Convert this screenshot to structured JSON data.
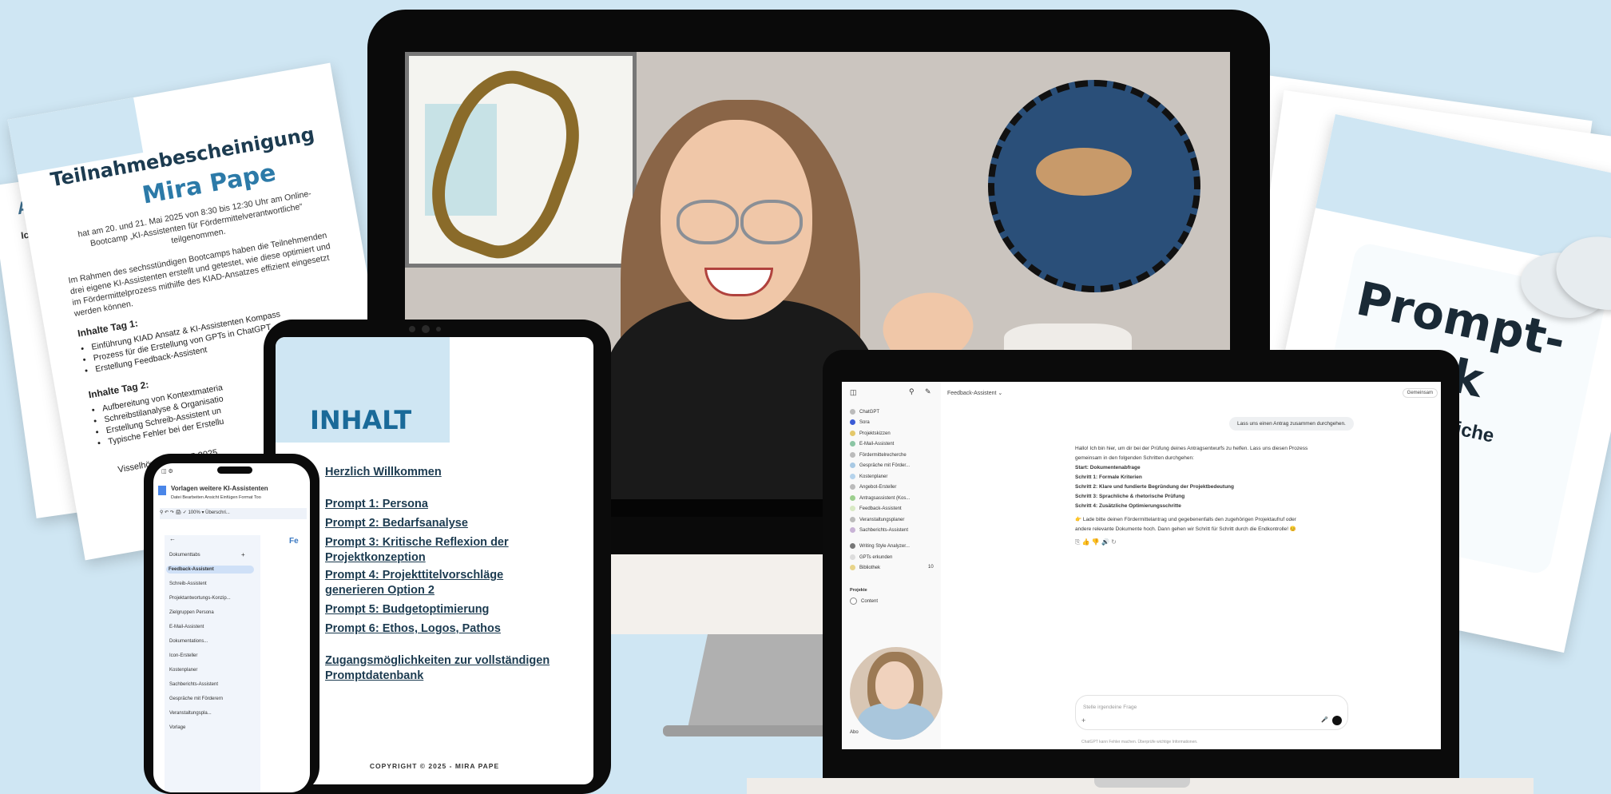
{
  "certificate": {
    "title": "Teilnahmebescheinigung",
    "name": "Mira Pape",
    "intro": "hat am 20. und 21. Mai 2025 von 8:30 bis 12:30 Uhr am Online-Bootcamp „KI-Assistenten für Fördermittelverantwortliche“ teilgenommen.",
    "body": "Im Rahmen des sechsstündigen Bootcamps haben die Teilnehmenden drei eigene KI-Assistenten erstellt und getestet, wie diese optimiert und im Fördermittelprozess mithilfe des KIAD-Ansatzes effizient eingesetzt werden können.",
    "day1_heading": "Inhalte Tag 1:",
    "day1_items": [
      "Einführung KIAD Ansatz & KI-Assistenten Kompass",
      "Prozess für die Erstellung von GPTs in ChatGPT",
      "Erstellung Feedback-Assistent"
    ],
    "day2_heading": "Inhalte Tag 2:",
    "day2_items": [
      "Aufbereitung von Kontextmateria",
      "Schreibstilanalyse & Organisatio",
      "Erstellung Schreib-Assistent un",
      "Typische Fehler bei der Erstellu"
    ],
    "place_date": "Visselhövede, 23.05.2025",
    "back_label": "Anle",
    "back_label2": "Icon"
  },
  "tablet": {
    "heading": "INHALT",
    "toc": [
      "Herzlich Willkommen",
      "Prompt 1: Persona",
      "Prompt 2: Bedarfsanalyse",
      "Prompt 3: Kritische Reflexion der Projektkonzeption",
      "Prompt 4: Projekttitelvorschläge generieren Option 2",
      "Prompt 5: Budgetoptimierung",
      "Prompt 6: Ethos, Logos, Pathos",
      "Zugangsmöglichkeiten zur vollständigen Promptdatenbank"
    ],
    "copyright": "COPYRIGHT © 2025 - MIRA PAPE"
  },
  "phone": {
    "doc_title": "Vorlagen weitere KI-Assistenten",
    "menu": [
      "Datei",
      "Bearbeiten",
      "Ansicht",
      "Einfügen",
      "Format",
      "Too"
    ],
    "zoom": "100%",
    "style": "Überschri...",
    "tabs_label": "Dokumenttabs",
    "items": [
      "Feedback-Assistent",
      "Schreib-Assistent",
      "Projektantwortungs-Konzip...",
      "Zielgruppen Persona",
      "E-Mail-Assistent",
      "Dokumentations...",
      "Icon-Ersteller",
      "Kostenplaner",
      "Sachberichts-Assistent",
      "Gespräche mit Förderern",
      "Veranstaltungspla...",
      "Vorlage"
    ],
    "side_text": "Fe"
  },
  "chatgpt": {
    "header": "Feedback-Assistent ⌄",
    "share": "Gemeinsam",
    "sidebar": [
      "ChatGPT",
      "Sora",
      "Projektskizzen",
      "E-Mail-Assistent",
      "Fördermittelrecherche",
      "Gespräche mit Förder...",
      "Kostenplaner",
      "Angebot-Ersteller",
      "Antragsassistent (Kos...",
      "Feedback-Assistent",
      "Veranstaltungsplaner",
      "Sachberichts-Assistent",
      "Writing Style Analyzer...",
      "GPTs erkunden",
      "Bibliothek"
    ],
    "library_count": "10",
    "projects_label": "Projekte",
    "projects": [
      "Content"
    ],
    "user_message": "Lass uns einen Antrag zusammen durchgehen.",
    "reply_intro_1": "Hallo! Ich bin hier, um dir bei der Prüfung deines Antragsentwurfs zu helfen. Lass uns diesen Prozess",
    "reply_intro_2": "gemeinsam in den folgenden Schritten durchgehen:",
    "steps": [
      "Start: Dokumentenabfrage",
      "Schritt 1: Formale Kriterien",
      "Schritt 2: Klare und fundierte Begründung der Projektbedeutung",
      "Schritt 3: Sprachliche & rhetorische Prüfung",
      "Schritt 4: Zusätzliche Optimierungsschritte"
    ],
    "reply_cta_1": "👉 Lade bitte deinen Fördermittelantrag und gegebenenfalls den zugehörigen Projektaufruf oder",
    "reply_cta_2": "andere relevante Dokumente hoch. Dann gehen wir Schritt für Schritt durch die Endkontrolle! 😊",
    "input_placeholder": "Stelle irgendeine Frage",
    "footer": "ChatGPT kann Fehler machen. Überprüfe wichtige Informationen.",
    "sidebar_user": "Abo"
  },
  "prompt_card": {
    "line1": "Prompt-",
    "line2": "nk",
    "line3": "tliche"
  }
}
